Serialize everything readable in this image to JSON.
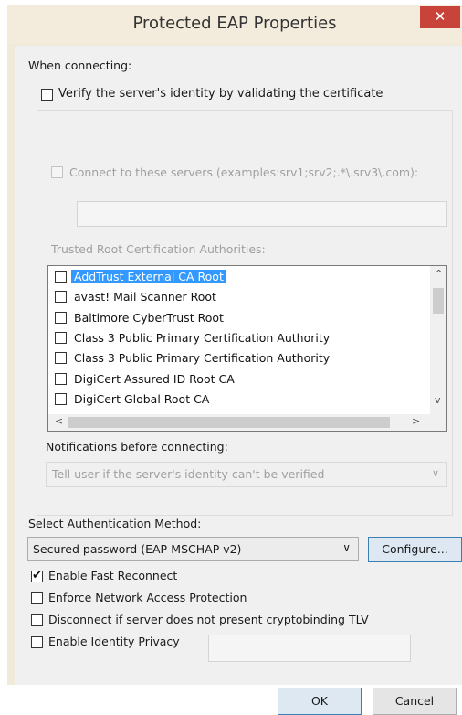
{
  "window": {
    "title": "Protected EAP Properties",
    "close_glyph": "✕"
  },
  "section_when_connecting": "When connecting:",
  "verify_identity": {
    "label": "Verify the server's identity by validating the certificate",
    "checked": false
  },
  "connect_servers": {
    "label": "Connect to these servers (examples:srv1;srv2;.*\\.srv3\\.com):",
    "value": ""
  },
  "trusted_root_label": "Trusted Root Certification Authorities:",
  "trusted_roots": [
    {
      "label": "AddTrust External CA Root",
      "checked": false,
      "selected": true
    },
    {
      "label": "avast! Mail Scanner Root",
      "checked": false,
      "selected": false
    },
    {
      "label": "Baltimore CyberTrust Root",
      "checked": false,
      "selected": false
    },
    {
      "label": "Class 3 Public Primary Certification Authority",
      "checked": false,
      "selected": false
    },
    {
      "label": "Class 3 Public Primary Certification Authority",
      "checked": false,
      "selected": false
    },
    {
      "label": "DigiCert Assured ID Root CA",
      "checked": false,
      "selected": false
    },
    {
      "label": "DigiCert Global Root CA",
      "checked": false,
      "selected": false
    }
  ],
  "scroll_glyphs": {
    "up": "^",
    "down": "v",
    "left": "<",
    "right": ">"
  },
  "notifications_label": "Notifications before connecting:",
  "notifications_value": "Tell user if the server's identity can't be verified",
  "auth_method_label": "Select Authentication Method:",
  "auth_method_value": "Secured password (EAP-MSCHAP v2)",
  "dropdown_glyph": "∨",
  "configure_button": "Configure...",
  "options": [
    {
      "id": "fast-reconnect",
      "label": "Enable Fast Reconnect",
      "checked": true
    },
    {
      "id": "nap",
      "label": "Enforce Network Access Protection",
      "checked": false
    },
    {
      "id": "cryptobinding",
      "label": "Disconnect if server does not present cryptobinding TLV",
      "checked": false
    },
    {
      "id": "identity-privacy",
      "label": "Enable Identity Privacy",
      "checked": false
    }
  ],
  "identity_privacy_value": "",
  "ok_button": "OK",
  "cancel_button": "Cancel"
}
